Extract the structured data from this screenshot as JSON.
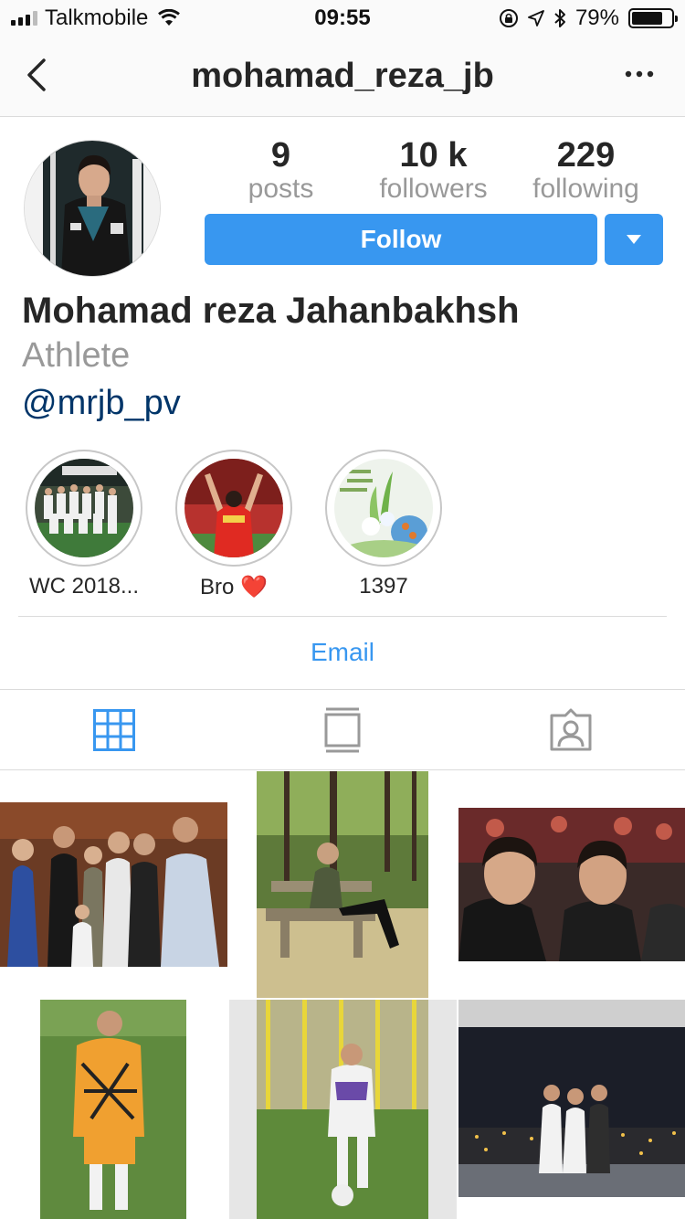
{
  "status_bar": {
    "carrier": "Talkmobile",
    "time": "09:55",
    "battery_percent": "79%",
    "battery_level": 0.79,
    "icons": [
      "signal-icon",
      "wifi-icon",
      "rotation-lock-icon",
      "location-icon",
      "bluetooth-icon",
      "battery-icon"
    ]
  },
  "nav": {
    "username": "mohamad_reza_jb",
    "back_icon": "chevron-left-icon",
    "more_icon": "more-options-icon"
  },
  "profile": {
    "posts_count": "9",
    "posts_label": "posts",
    "followers_count": "10 k",
    "followers_label": "followers",
    "following_count": "229",
    "following_label": "following",
    "follow_button_label": "Follow",
    "full_name": "Mohamad reza Jahanbakhsh",
    "category": "Athlete",
    "handle": "@mrjb_pv"
  },
  "highlights": [
    {
      "label": "WC 2018..."
    },
    {
      "label": "Bro ❤️"
    },
    {
      "label": "1397"
    }
  ],
  "contact": {
    "email_label": "Email"
  },
  "tabs": [
    {
      "icon": "grid-icon",
      "active": true
    },
    {
      "icon": "feed-icon",
      "active": false
    },
    {
      "icon": "tagged-icon",
      "active": false
    }
  ],
  "colors": {
    "accent": "#3897f0",
    "link": "#003569",
    "secondary_text": "#999999"
  }
}
